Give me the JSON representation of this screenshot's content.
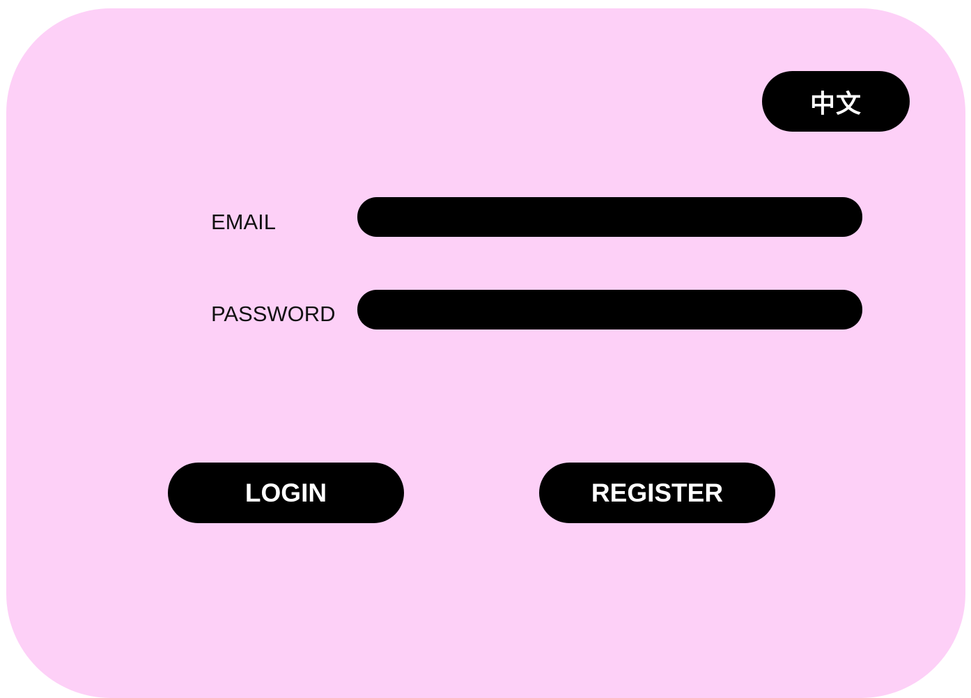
{
  "header": {
    "language_toggle_label": "中文"
  },
  "form": {
    "email": {
      "label": "EMAIL",
      "value": "",
      "placeholder": ""
    },
    "password": {
      "label": "PASSWORD",
      "value": "",
      "placeholder": ""
    }
  },
  "actions": {
    "login_label": "LOGIN",
    "register_label": "REGISTER"
  },
  "colors": {
    "background": "#fdd0f7",
    "controls": "#000000",
    "control_text": "#ffffff",
    "label_text": "#111111"
  }
}
